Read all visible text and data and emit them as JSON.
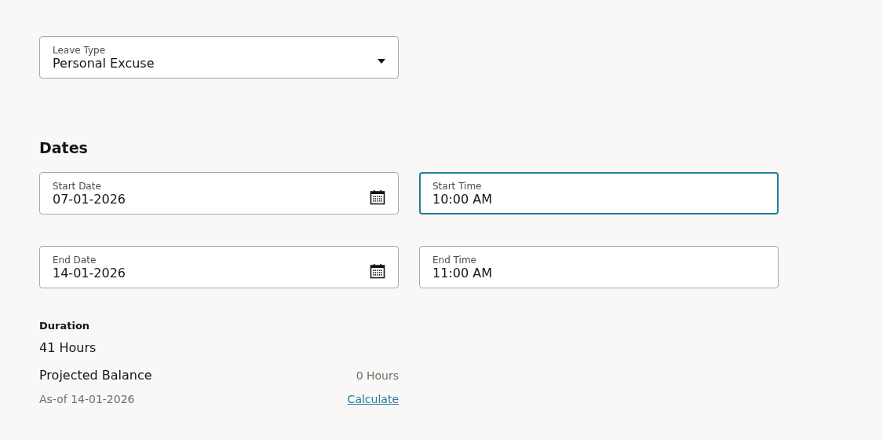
{
  "leave_type": {
    "label": "Leave Type",
    "value": "Personal Excuse",
    "kind": "select",
    "focused": false
  },
  "dates": {
    "heading": "Dates",
    "fields": [
      {
        "label": "Start Date",
        "value": "07-01-2026",
        "kind": "date",
        "focused": false
      },
      {
        "label": "Start Time",
        "value": "10:00 AM",
        "kind": "time",
        "focused": true
      },
      {
        "label": "End Date",
        "value": "14-01-2026",
        "kind": "date",
        "focused": false
      },
      {
        "label": "End Time",
        "value": "11:00 AM",
        "kind": "time",
        "focused": false
      }
    ]
  },
  "duration": {
    "label": "Duration",
    "value": "41 Hours"
  },
  "projected_balance": {
    "label": "Projected Balance",
    "value": "0 Hours",
    "as_of": "As-of 14-01-2026",
    "link": "Calculate"
  }
}
